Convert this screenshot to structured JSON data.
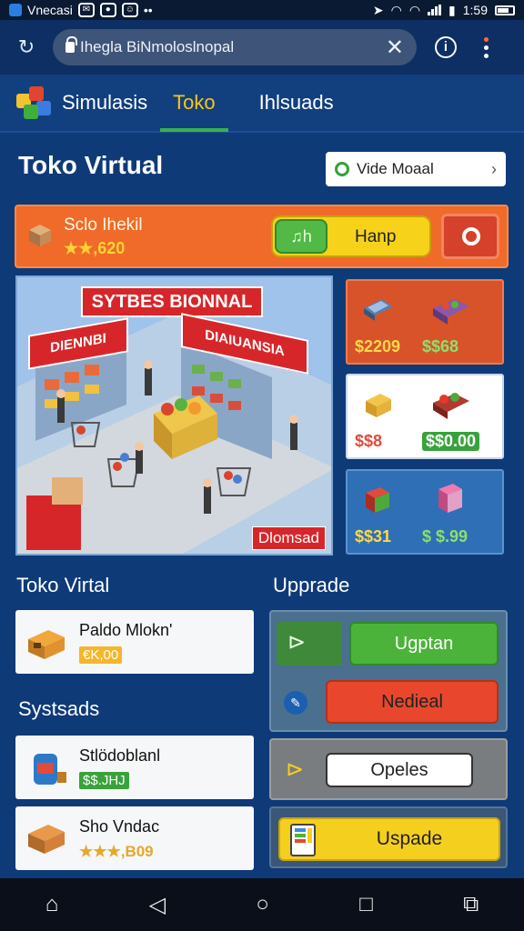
{
  "status_bar": {
    "app_label": "Vnecasi",
    "time": "1:59"
  },
  "browser": {
    "url": "Ihegla BiNmoloslnopal"
  },
  "tabs": [
    {
      "label": "Simulasis"
    },
    {
      "label": "Toko",
      "active": true
    },
    {
      "label": "Ihlsuads"
    }
  ],
  "header": {
    "title": "Toko Virtual",
    "mode_button": "Vide Moaal"
  },
  "banner": {
    "name": "Sclo Ihekil",
    "stars": "★★,620",
    "pill_left": "♫h",
    "pill_label": "Hanp"
  },
  "scene": {
    "sign_main": "SYTBES BIONNAL",
    "sign_left": "DIENNBI",
    "sign_right": "DIAIUANSIA",
    "corner_tag": "Dlomsad"
  },
  "products": [
    {
      "price1": "$2209",
      "price2": "$$68"
    },
    {
      "price1": "$$8",
      "price2": "$$0.00"
    },
    {
      "price1": "$$31",
      "price2": "$ $.99"
    }
  ],
  "sections": {
    "left_title": "Toko Virtal",
    "right_title": "Upprade",
    "systems_title": "Systsads"
  },
  "shop_item": {
    "name": "Paldo Mlokn'",
    "tag": "€K,00"
  },
  "system_items": [
    {
      "name": "Stlödoblanl",
      "tag": "$$.JНJ"
    },
    {
      "name": "Sho Vndac",
      "tag": "★★★,B09"
    }
  ],
  "upgrades": {
    "primary": "Ugptan",
    "secondary": "Nedieal",
    "option": "Opeles",
    "final": "Uspade"
  },
  "colors": {
    "orange": "#f06a2a",
    "yellow": "#f4cf1e",
    "green": "#4cb33a",
    "red": "#e8472d",
    "bg": "#0e3a78"
  }
}
